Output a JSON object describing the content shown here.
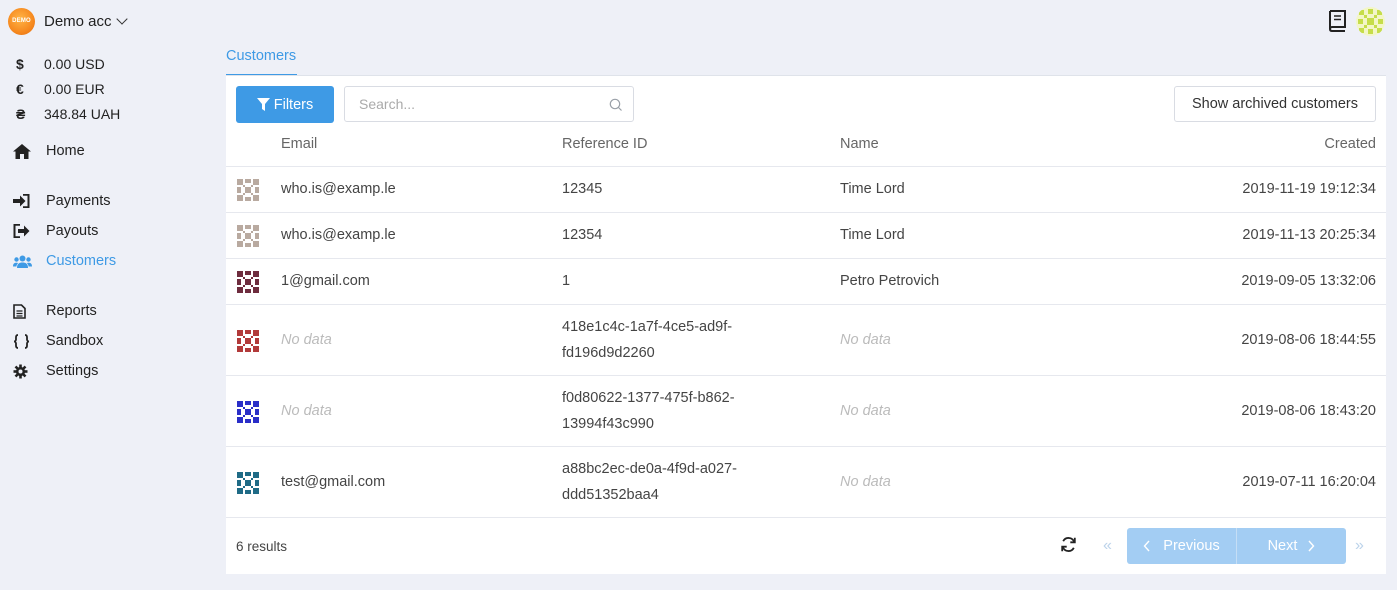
{
  "account": {
    "logo_text": "DEMO",
    "name": "Demo acc"
  },
  "balances": [
    {
      "symbol": "$",
      "amount": "0.00 USD"
    },
    {
      "symbol": "€",
      "amount": "0.00 EUR"
    },
    {
      "symbol": "₴",
      "amount": "348.84 UAH"
    }
  ],
  "nav": {
    "home": "Home",
    "payments": "Payments",
    "payouts": "Payouts",
    "customers": "Customers",
    "reports": "Reports",
    "sandbox": "Sandbox",
    "settings": "Settings"
  },
  "tabs": {
    "customers": "Customers"
  },
  "toolbar": {
    "filters_label": "Filters",
    "search_placeholder": "Search...",
    "archived_label": "Show archived customers"
  },
  "table": {
    "headers": {
      "email": "Email",
      "reference": "Reference ID",
      "name": "Name",
      "created": "Created"
    },
    "rows": [
      {
        "email": "who.is@examp.le",
        "reference": "12345",
        "ref_line2": "",
        "name": "Time Lord",
        "created": "2019-11-19 19:12:34",
        "avatar_color": "#b9aaa0"
      },
      {
        "email": "who.is@examp.le",
        "reference": "12354",
        "ref_line2": "",
        "name": "Time Lord",
        "created": "2019-11-13 20:25:34",
        "avatar_color": "#b9aaa0"
      },
      {
        "email": "1@gmail.com",
        "reference": "1",
        "ref_line2": "",
        "name": "Petro Petrovich",
        "created": "2019-09-05 13:32:06",
        "avatar_color": "#6e2c3e"
      },
      {
        "email": "No data",
        "reference": "418e1c4c-1a7f-4ce5-ad9f-",
        "ref_line2": "fd196d9d2260",
        "name": "No data",
        "created": "2019-08-06 18:44:55",
        "avatar_color": "#b23a3a"
      },
      {
        "email": "No data",
        "reference": "f0d80622-1377-475f-b862-",
        "ref_line2": "13994f43c990",
        "name": "No data",
        "created": "2019-08-06 18:43:20",
        "avatar_color": "#2a2ec8"
      },
      {
        "email": "test@gmail.com",
        "reference": "a88bc2ec-de0a-4f9d-a027-",
        "ref_line2": "ddd51352baa4",
        "name": "No data",
        "created": "2019-07-11 16:20:04",
        "avatar_color": "#1f6b86"
      }
    ]
  },
  "footer": {
    "results": "6 results",
    "first_glyph": "«",
    "previous_label": "Previous",
    "next_label": "Next",
    "last_glyph": "»"
  },
  "colors": {
    "accent": "#3e9ae5",
    "pager": "#a3cdf3",
    "background": "#eef0f7"
  }
}
